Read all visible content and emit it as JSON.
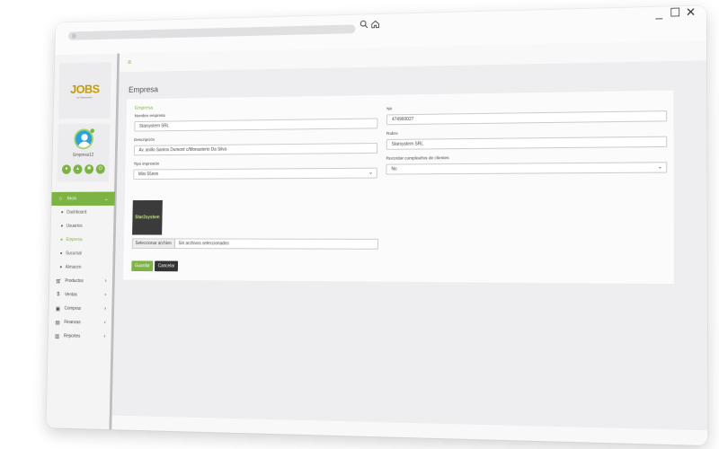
{
  "browser": {
    "search_icon": "magnifier-icon",
    "home_icon": "home-icon",
    "controls": {
      "minimize": "_",
      "maximize": "☐",
      "close": "✕"
    }
  },
  "sidebar": {
    "logo": "JOBS",
    "logo_sub": "by Starsystem",
    "user": {
      "name": "Empresa12"
    },
    "user_actions": [
      "user-icon",
      "chart-icon",
      "settings-icon",
      "power-icon"
    ],
    "nav": [
      {
        "label": "Inicio",
        "icon": "home-icon",
        "active": true,
        "children": [
          {
            "label": "Dashboard",
            "active": false
          },
          {
            "label": "Usuarios",
            "active": false
          },
          {
            "label": "Empresa",
            "active": true
          },
          {
            "label": "Sucursal",
            "active": false
          },
          {
            "label": "Almacen",
            "active": false
          }
        ]
      },
      {
        "label": "Productos",
        "icon": "cart-icon"
      },
      {
        "label": "Ventas",
        "icon": "dollar-icon"
      },
      {
        "label": "Compras",
        "icon": "box-icon"
      },
      {
        "label": "Finanzas",
        "icon": "ledger-icon"
      },
      {
        "label": "Reportes",
        "icon": "bar-chart-icon"
      }
    ]
  },
  "page": {
    "title": "Empresa"
  },
  "form": {
    "section_title": "Empresa",
    "nombre_label": "Nombre empresa",
    "nombre_value": "Starsystem SRL",
    "nit_label": "Nit",
    "nit_value": "474960027",
    "descripcion_label": "Descripción",
    "descripcion_value": "Av. anillo Santos Dumont c/Monasterio Da Silva",
    "rubro_label": "Rubro",
    "rubro_value": "Starsystem SRL",
    "tipo_label": "Tipo impresión",
    "tipo_value": "Mini 55mm",
    "recordar_label": "Recordar cumpleaños de clientes",
    "recordar_value": "No",
    "logo_preview_text": "Star2system",
    "file_button": "Seleccionar archivo",
    "file_status": "Sin archivos seleccionados",
    "save_label": "Guardar",
    "cancel_label": "Cancelar"
  }
}
